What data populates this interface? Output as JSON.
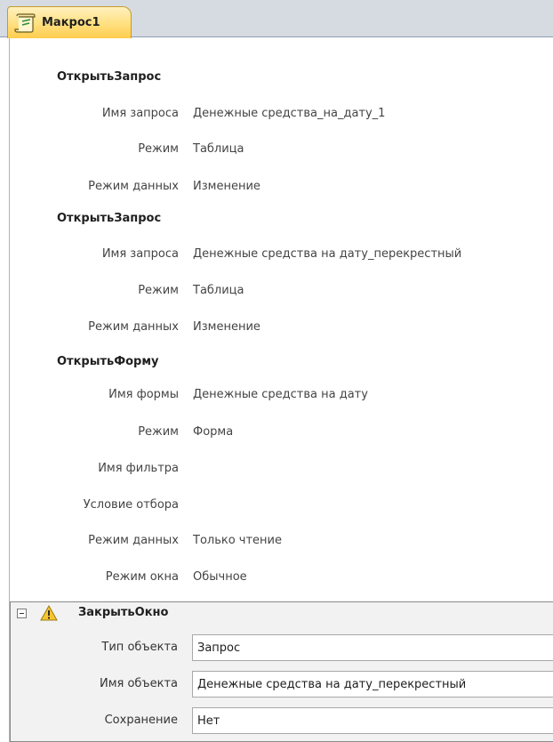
{
  "tab": {
    "title": "Макрос1",
    "icon": "macro-scroll-icon"
  },
  "actions": [
    {
      "name": "ОткрытьЗапрос",
      "args": [
        {
          "label": "Имя запроса",
          "value": "Денежные средства_на_дату_1"
        },
        {
          "label": "Режим",
          "value": "Таблица"
        },
        {
          "label": "Режим данных",
          "value": "Изменение"
        }
      ]
    },
    {
      "name": "ОткрытьЗапрос",
      "args": [
        {
          "label": "Имя запроса",
          "value": "Денежные средства на дату_перекрестный"
        },
        {
          "label": "Режим",
          "value": "Таблица"
        },
        {
          "label": "Режим данных",
          "value": "Изменение"
        }
      ]
    },
    {
      "name": "ОткрытьФорму",
      "args": [
        {
          "label": "Имя формы",
          "value": "Денежные средства на дату"
        },
        {
          "label": "Режим",
          "value": "Форма"
        },
        {
          "label": "Имя фильтра",
          "value": ""
        },
        {
          "label": "Условие отбора",
          "value": ""
        },
        {
          "label": "Режим данных",
          "value": "Только чтение"
        },
        {
          "label": "Режим окна",
          "value": "Обычное"
        }
      ]
    }
  ],
  "selected_action": {
    "name": "ЗакрытьОкно",
    "collapse_icon": "collapse-minus-icon",
    "warning_icon": "warning-icon",
    "args": [
      {
        "label": "Тип объекта",
        "value": "Запрос"
      },
      {
        "label": "Имя объекта",
        "value": "Денежные средства на дату_перекрестный"
      },
      {
        "label": "Сохранение",
        "value": "Нет"
      }
    ]
  },
  "colors": {
    "tab_gold": "#ffcd4e",
    "selected_block_bg": "#f2f2f2",
    "warning_yellow": "#f7c531"
  }
}
